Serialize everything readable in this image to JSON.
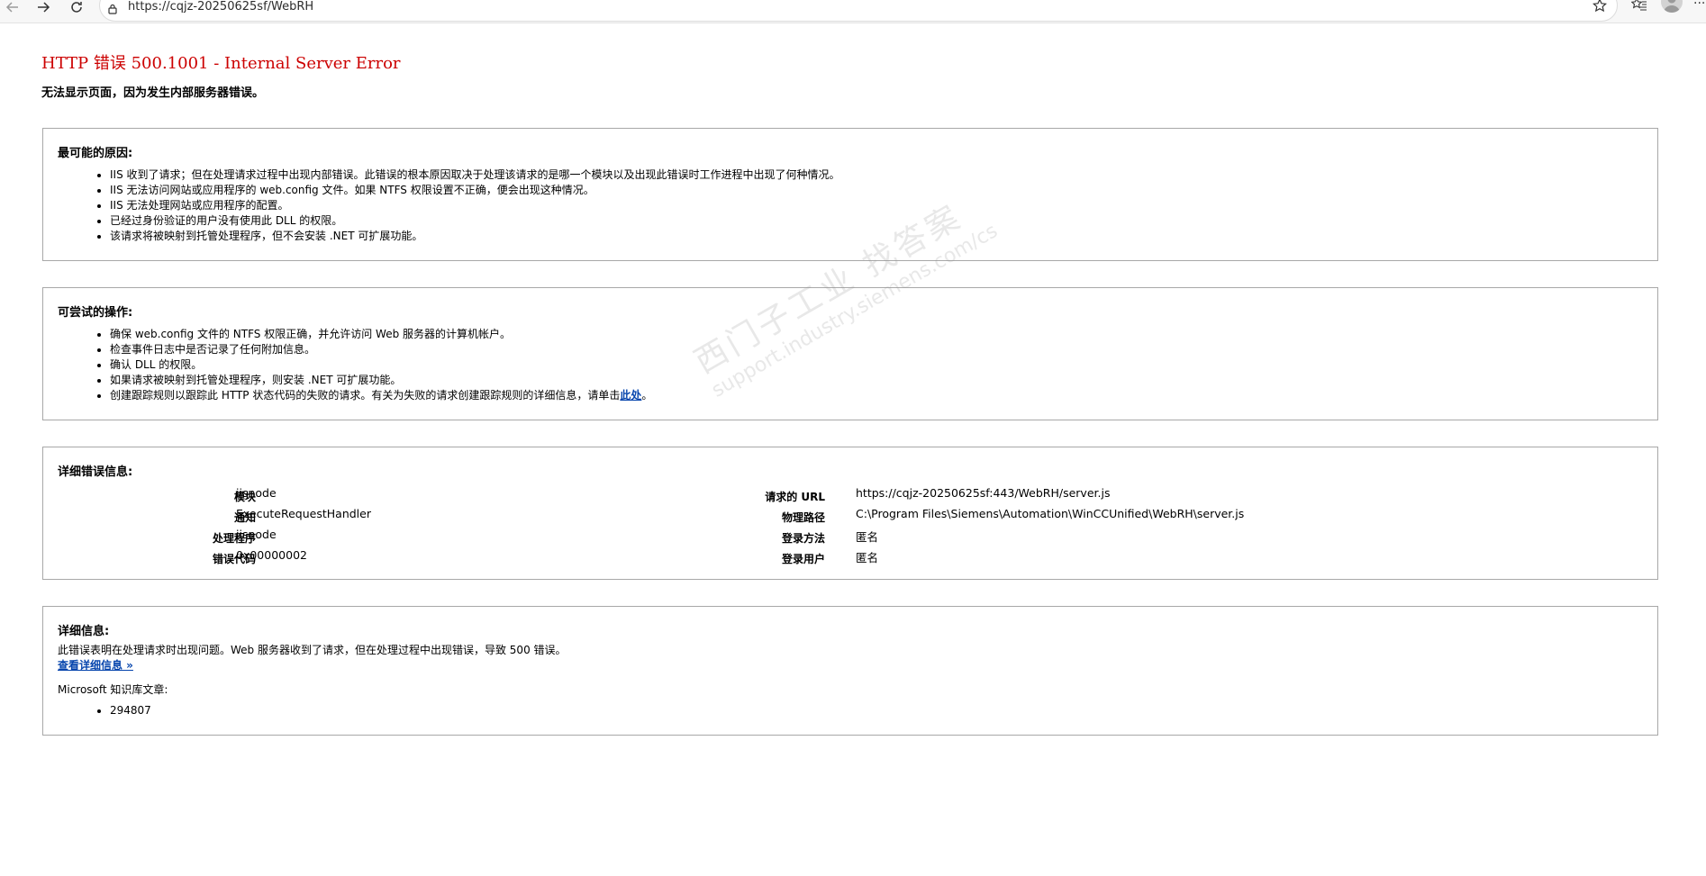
{
  "browser": {
    "url": "https://cqjz-20250625sf/WebRH"
  },
  "page": {
    "title": "HTTP 错误 500.1001 - Internal Server Error",
    "subtitle": "无法显示页面，因为发生内部服务器错误。"
  },
  "causes": {
    "heading": "最可能的原因:",
    "items": [
      "IIS 收到了请求；但在处理请求过程中出现内部错误。此错误的根本原因取决于处理该请求的是哪一个模块以及出现此错误时工作进程中出现了何种情况。",
      "IIS 无法访问网站或应用程序的 web.config 文件。如果 NTFS 权限设置不正确，便会出现这种情况。",
      "IIS 无法处理网站或应用程序的配置。",
      "已经过身份验证的用户没有使用此 DLL 的权限。",
      "该请求将被映射到托管处理程序，但不会安装 .NET 可扩展功能。"
    ]
  },
  "actions": {
    "heading": "可尝试的操作:",
    "items": [
      "确保 web.config 文件的 NTFS 权限正确，并允许访问 Web 服务器的计算机帐户。",
      "检查事件日志中是否记录了任何附加信息。",
      "确认 DLL 的权限。",
      "如果请求被映射到托管处理程序，则安装 .NET 可扩展功能。"
    ],
    "last_item_text": "创建跟踪规则以跟踪此 HTTP 状态代码的失败的请求。有关为失败的请求创建跟踪规则的详细信息，请单击",
    "last_item_link": "此处",
    "last_item_suffix": "。"
  },
  "details": {
    "heading": "详细错误信息:",
    "left": [
      {
        "key": "模块",
        "value": "iisnode"
      },
      {
        "key": "通知",
        "value": "ExecuteRequestHandler"
      },
      {
        "key": "处理程序",
        "value": "iisnode"
      },
      {
        "key": "错误代码",
        "value": "0x00000002"
      }
    ],
    "right": [
      {
        "key": "请求的 URL",
        "value": "https://cqjz-20250625sf:443/WebRH/server.js"
      },
      {
        "key": "物理路径",
        "value": "C:\\Program Files\\Siemens\\Automation\\WinCCUnified\\WebRH\\server.js"
      },
      {
        "key": "登录方法",
        "value": "匿名"
      },
      {
        "key": "登录用户",
        "value": "匿名"
      }
    ]
  },
  "more_info": {
    "heading": "详细信息:",
    "description": "此错误表明在处理请求时出现问题。Web 服务器收到了请求，但在处理过程中出现错误，导致 500 错误。",
    "link": "查看详细信息 »",
    "kb_label": "Microsoft 知识库文章:",
    "kb_items": [
      "294807"
    ]
  },
  "watermark": {
    "line1": "西门子工业  找答案",
    "line2": "support.industry.siemens.com/cs"
  }
}
